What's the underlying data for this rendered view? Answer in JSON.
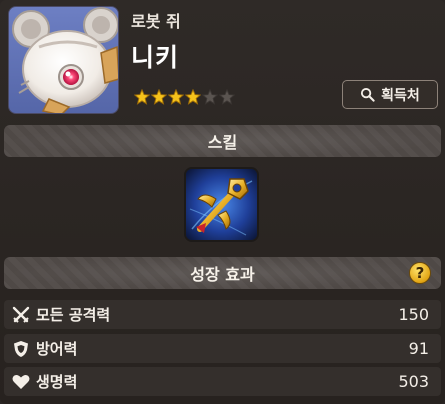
{
  "cookie": {
    "subtitle": "로봇 쥐",
    "name": "니키",
    "stars_filled": 4,
    "stars_total": 6
  },
  "buttons": {
    "acquire_label": "획득처"
  },
  "sections": {
    "skill_title": "스킬",
    "growth_title": "성장 효과",
    "help_symbol": "?"
  },
  "stats": [
    {
      "label": "모든 공격력",
      "value": "150",
      "icon": "crossed-swords-icon"
    },
    {
      "label": "방어력",
      "value": "91",
      "icon": "shield-icon"
    },
    {
      "label": "생명력",
      "value": "503",
      "icon": "heart-icon"
    }
  ],
  "colors": {
    "star_filled": "#f5c21b",
    "star_empty": "#5a5450",
    "help_icon": "#f0b820",
    "section_bg": "#4f4946",
    "row_bg": "#342f2c"
  }
}
